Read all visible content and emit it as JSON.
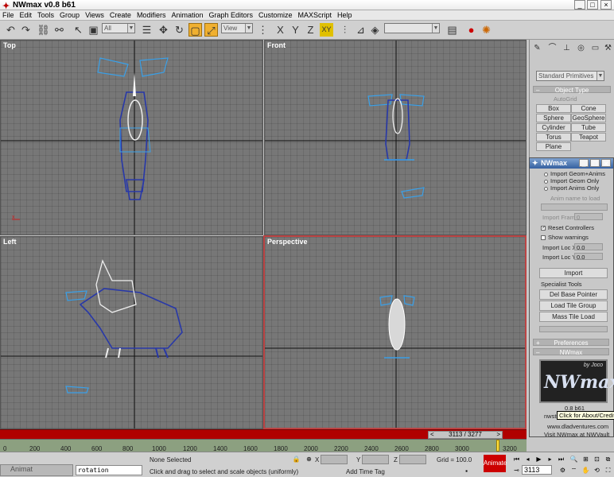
{
  "window": {
    "title": "NWmax v0.8 b61",
    "min": "_",
    "max": "□",
    "close": "×"
  },
  "menu": [
    "File",
    "Edit",
    "Tools",
    "Group",
    "Views",
    "Create",
    "Modifiers",
    "Animation",
    "Graph Editors",
    "Customize",
    "MAXScript",
    "Help"
  ],
  "toolbar": {
    "selection_filter": "All",
    "coord_system": "View",
    "named_selection": ""
  },
  "viewports": {
    "top": "Top",
    "front": "Front",
    "left": "Left",
    "perspective": "Perspective"
  },
  "command_panel": {
    "category": "Standard Primitives",
    "object_type_header": "Object Type",
    "autogrid_label": "AutoGrid",
    "buttons": [
      "Box",
      "Cone",
      "Sphere",
      "GeoSphere",
      "Cylinder",
      "Tube",
      "Torus",
      "Teapot",
      "Plane"
    ]
  },
  "nwmax_panel": {
    "title": "NWmax",
    "radio_options": [
      "Import Geom+Anims",
      "Import Geom Only",
      "Import Anims Only"
    ],
    "anim_name_button": "Anim name to load",
    "import_frame_label": "Import Frame",
    "import_frame_value": "0",
    "reset_controllers": "Reset Controllers",
    "show_warnings": "Show warnings",
    "import_loc_x_label": "Import Loc X:",
    "import_loc_x_value": "0.0",
    "import_loc_y_label": "Import Loc Y:",
    "import_loc_y_value": "0.0",
    "import_button": "Import",
    "specialist_tools": "Specialist Tools",
    "del_base_pointer": "Del Base Pointer",
    "load_tile_group": "Load Tile Group",
    "mass_tile_load": "Mass Tile Load",
    "preferences": "Preferences",
    "nwmax_rollout": "NWmax",
    "logo_by": "by Joco",
    "logo_text": "NWmax",
    "version": "0.8 b61",
    "credits_partial": "nwstu",
    "website": "www.dladventures.com",
    "visit": "Visit NWmax at NWVault"
  },
  "tooltip": "Click for About/Credits.",
  "timeline": {
    "slider": "3113 / 3277",
    "ticks": [
      "0",
      "200",
      "400",
      "600",
      "800",
      "1000",
      "1200",
      "1400",
      "1600",
      "1800",
      "2000",
      "2200",
      "2400",
      "2600",
      "2800",
      "3000",
      "3200"
    ]
  },
  "status": {
    "listener_title": "Animat",
    "listener_text": "rotation",
    "selection": "None Selected",
    "prompt": "Click and drag to select and scale objects (uniformly)",
    "x_label": "X",
    "y_label": "Y",
    "z_label": "Z",
    "grid": "Grid = 100.0",
    "add_time_tag": "Add Time Tag",
    "animate": "Animate",
    "frame": "3113"
  },
  "colors": {
    "accent_red": "#b00000",
    "active_border": "#b44444",
    "highlight": "#f0b030",
    "link_blue": "#2060c0"
  }
}
